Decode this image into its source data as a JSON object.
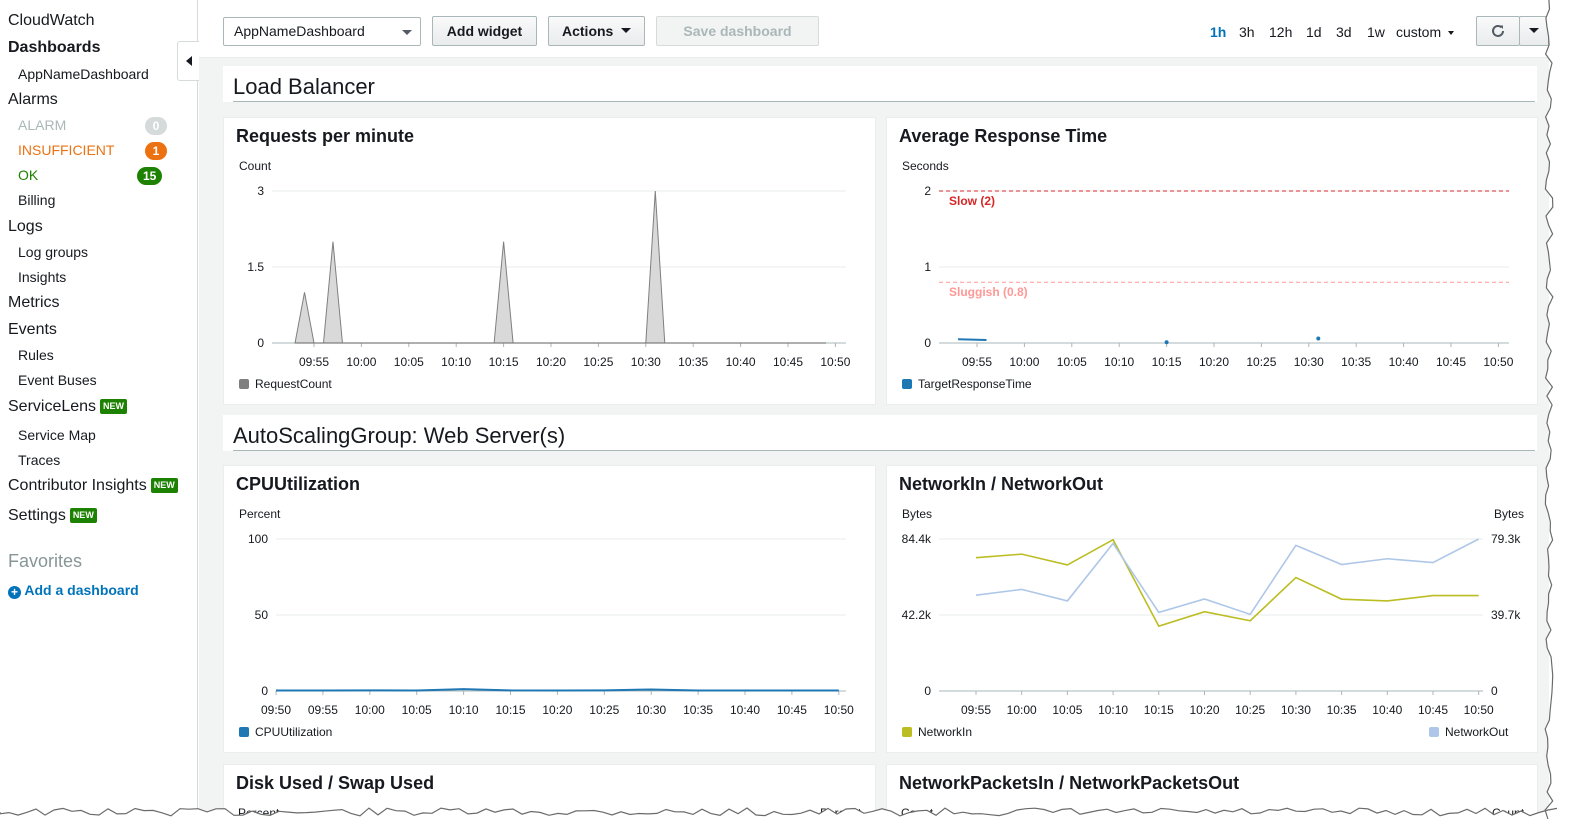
{
  "sidebar": {
    "service": "CloudWatch",
    "dashboards": "Dashboards",
    "current_dashboard": "AppNameDashboard",
    "alarms": "Alarms",
    "alarm_items": [
      {
        "label": "ALARM",
        "count": "0",
        "color": "#d5dbdb"
      },
      {
        "label": "INSUFFICIENT",
        "count": "1",
        "color": "#ec7211"
      },
      {
        "label": "OK",
        "count": "15",
        "color": "#1d8102"
      }
    ],
    "billing": "Billing",
    "logs": "Logs",
    "log_groups": "Log groups",
    "insights": "Insights",
    "metrics": "Metrics",
    "events": "Events",
    "rules": "Rules",
    "event_buses": "Event Buses",
    "servicelens": "ServiceLens",
    "service_map": "Service Map",
    "traces": "Traces",
    "contributor_insights": "Contributor Insights",
    "settings": "Settings",
    "new_tag": "NEW",
    "favorites": "Favorites",
    "add_dashboard": "Add a dashboard"
  },
  "toolbar": {
    "dashboard_select": "AppNameDashboard",
    "add_widget": "Add widget",
    "actions": "Actions",
    "save_dashboard": "Save dashboard",
    "time_ranges": [
      "1h",
      "3h",
      "12h",
      "1d",
      "3d",
      "1w"
    ],
    "active_range": "1h",
    "custom": "custom"
  },
  "sections": {
    "load_balancer": "Load Balancer",
    "asg": "AutoScalingGroup: Web Server(s)"
  },
  "time_ticks_a": [
    "09:55",
    "10:00",
    "10:05",
    "10:10",
    "10:15",
    "10:20",
    "10:25",
    "10:30",
    "10:35",
    "10:40",
    "10:45",
    "10:50"
  ],
  "time_ticks_b": [
    "09:50",
    "09:55",
    "10:00",
    "10:05",
    "10:10",
    "10:15",
    "10:20",
    "10:25",
    "10:30",
    "10:35",
    "10:40",
    "10:45",
    "10:50"
  ],
  "widgets": {
    "requests": {
      "title": "Requests per minute",
      "unit": "Count",
      "yticks": [
        "3",
        "1.5",
        "0"
      ],
      "legend": "RequestCount",
      "color": "#7f7f7f"
    },
    "response": {
      "title": "Average Response Time",
      "unit": "Seconds",
      "yticks": [
        "2",
        "1",
        "0"
      ],
      "legend": "TargetResponseTime",
      "color": "#1f77b4",
      "annotations": [
        {
          "label": "Slow (2)",
          "value": 2,
          "color": "#d62728"
        },
        {
          "label": "Sluggish (0.8)",
          "value": 0.8,
          "color": "#ff9896"
        }
      ]
    },
    "cpu": {
      "title": "CPUUtilization",
      "unit": "Percent",
      "yticks": [
        "100",
        "50",
        "0"
      ],
      "legend": "CPUUtilization",
      "color": "#1f77b4"
    },
    "network": {
      "title": "NetworkIn / NetworkOut",
      "unit_left": "Bytes",
      "unit_right": "Bytes",
      "yticks_left": [
        "84.4k",
        "42.2k",
        "0"
      ],
      "yticks_right": [
        "79.3k",
        "39.7k",
        "0"
      ],
      "legend_in": "NetworkIn",
      "legend_out": "NetworkOut",
      "color_in": "#bcbd22",
      "color_out": "#aec7e8"
    },
    "disk": {
      "title": "Disk Used / Swap Used",
      "unit_left": "Percent",
      "unit_right": "Percent"
    },
    "packets": {
      "title": "NetworkPacketsIn / NetworkPacketsOut",
      "unit_left": "Count",
      "unit_right": "Count"
    }
  },
  "chart_data": [
    {
      "type": "area",
      "title": "Requests per minute",
      "ylabel": "Count",
      "ylim": [
        0,
        3
      ],
      "x": [
        "09:53",
        "09:54",
        "09:55",
        "09:56",
        "09:57",
        "09:58",
        "10:14",
        "10:15",
        "10:16",
        "10:30",
        "10:31",
        "10:32"
      ],
      "series": [
        {
          "name": "RequestCount",
          "values": [
            0,
            1,
            0,
            0,
            2,
            0,
            0,
            2,
            0,
            0,
            3,
            0
          ]
        }
      ]
    },
    {
      "type": "scatter",
      "title": "Average Response Time",
      "ylabel": "Seconds",
      "ylim": [
        0,
        2
      ],
      "x": [
        "09:53",
        "09:56",
        "10:15",
        "10:31"
      ],
      "series": [
        {
          "name": "TargetResponseTime",
          "values": [
            0.05,
            0.04,
            0.01,
            0.06
          ]
        }
      ]
    },
    {
      "type": "line",
      "title": "CPUUtilization",
      "ylabel": "Percent",
      "ylim": [
        0,
        100
      ],
      "x": [
        "09:50",
        "09:55",
        "10:00",
        "10:05",
        "10:10",
        "10:15",
        "10:20",
        "10:25",
        "10:30",
        "10:35",
        "10:40",
        "10:45",
        "10:50"
      ],
      "series": [
        {
          "name": "CPUUtilization",
          "values": [
            0.3,
            0.3,
            0.4,
            0.3,
            1.2,
            0.4,
            0.3,
            0.4,
            1.0,
            0.3,
            0.3,
            0.3,
            0.3
          ]
        }
      ]
    },
    {
      "type": "line",
      "title": "NetworkIn / NetworkOut",
      "ylabel": "Bytes",
      "x": [
        "09:55",
        "10:00",
        "10:05",
        "10:10",
        "10:15",
        "10:20",
        "10:25",
        "10:30",
        "10:35",
        "10:40",
        "10:45",
        "10:50"
      ],
      "series": [
        {
          "name": "NetworkIn",
          "axis": "left",
          "ylim": [
            0,
            84400
          ],
          "values": [
            74000,
            76000,
            70000,
            84000,
            36000,
            44000,
            39000,
            63000,
            51000,
            50000,
            53000,
            53000
          ]
        },
        {
          "name": "NetworkOut",
          "axis": "right",
          "ylim": [
            0,
            79300
          ],
          "values": [
            50000,
            53000,
            47000,
            77000,
            41000,
            48000,
            40000,
            76000,
            66000,
            69000,
            67000,
            79300
          ]
        }
      ]
    }
  ]
}
